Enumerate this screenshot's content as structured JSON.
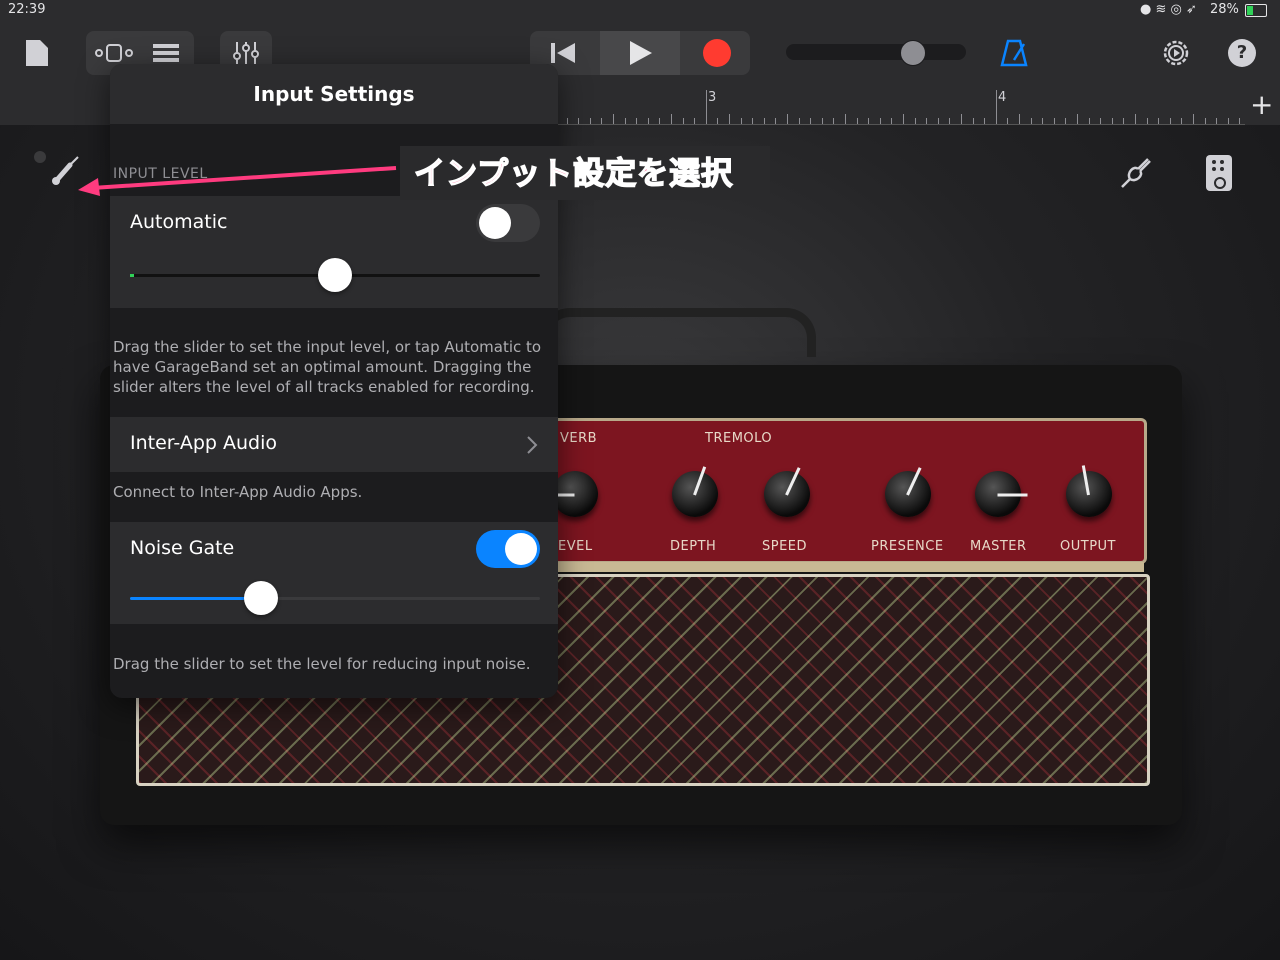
{
  "status_bar": {
    "time": "22:39",
    "battery": "28%"
  },
  "toolbar": {
    "ruler_marks": [
      "3",
      "4"
    ],
    "add_label": "+"
  },
  "popover": {
    "title": "Input Settings",
    "input_level_header": "INPUT LEVEL",
    "automatic_label": "Automatic",
    "automatic_on": false,
    "input_level_value": 0.5,
    "input_level_note": "Drag the slider to set the input level, or tap Automatic to have GarageBand set an optimal amount. Dragging the slider alters the level of all tracks enabled for recording.",
    "inter_app_label": "Inter-App Audio",
    "inter_app_note": "Connect to Inter-App Audio Apps.",
    "noise_gate_label": "Noise Gate",
    "noise_gate_on": true,
    "noise_gate_value": 0.32,
    "noise_gate_note": "Drag the slider to set the level for reducing input noise."
  },
  "annotation": {
    "text": "インプット設定を選択",
    "color": "#ff3b7f"
  },
  "amp": {
    "top_labels": [
      "VERB",
      "TREMOLO"
    ],
    "bottom_labels": [
      "EVEL",
      "DEPTH",
      "SPEED",
      "PRESENCE",
      "MASTER",
      "OUTPUT"
    ]
  },
  "colors": {
    "accent": "#0a84ff",
    "record": "#ff3b30",
    "metronome": "#0a84ff"
  }
}
